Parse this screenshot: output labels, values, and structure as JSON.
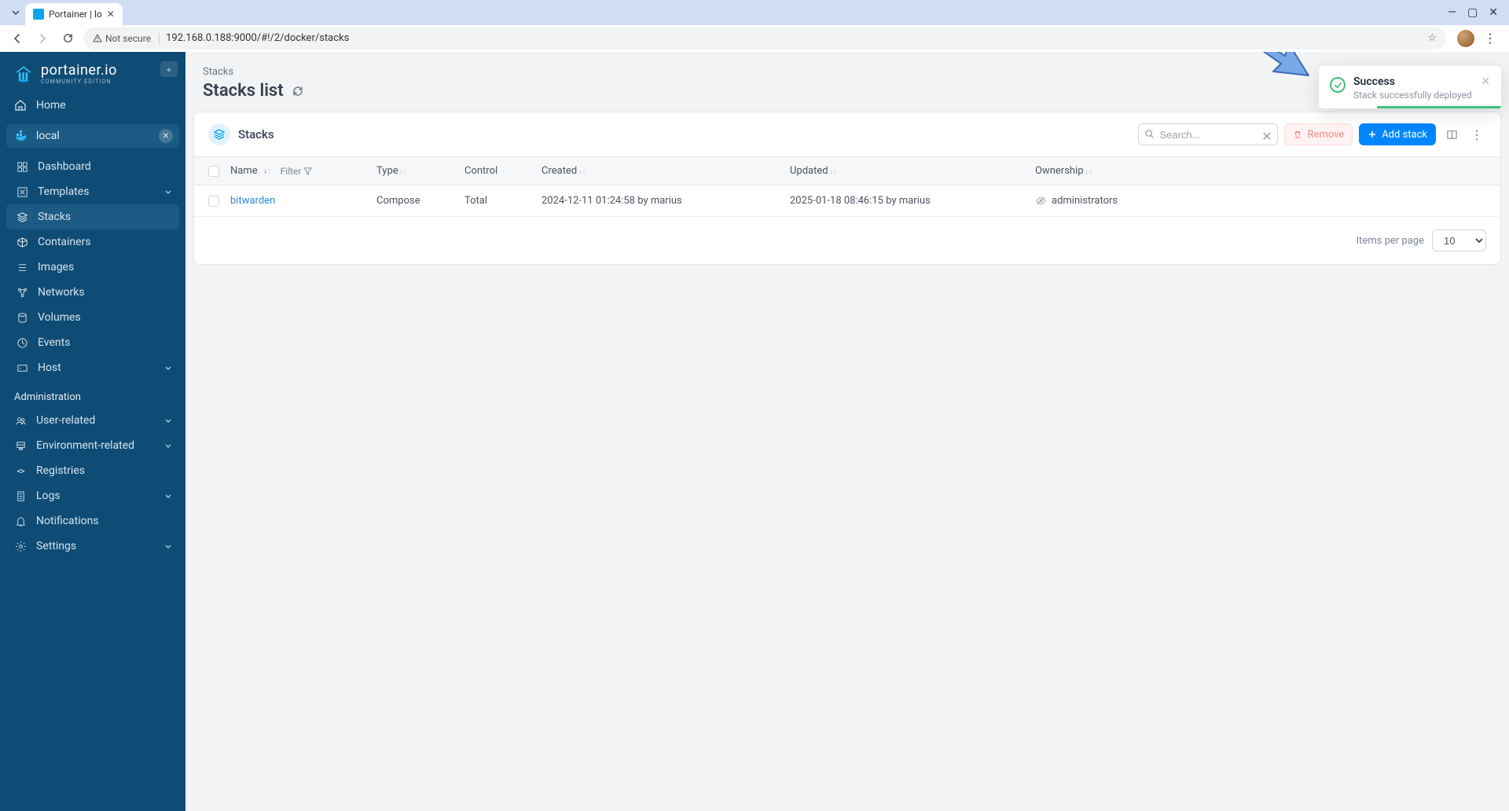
{
  "browser": {
    "tab_title": "Portainer | lo",
    "secure_label": "Not secure",
    "url": "192.168.0.188:9000/#!/2/docker/stacks"
  },
  "sidebar": {
    "product_name": "portainer.io",
    "edition": "COMMUNITY EDITION",
    "home": "Home",
    "env_name": "local",
    "items": {
      "dashboard": "Dashboard",
      "templates": "Templates",
      "stacks": "Stacks",
      "containers": "Containers",
      "images": "Images",
      "networks": "Networks",
      "volumes": "Volumes",
      "events": "Events",
      "host": "Host"
    },
    "admin_label": "Administration",
    "admin": {
      "user": "User-related",
      "env": "Environment-related",
      "registries": "Registries",
      "logs": "Logs",
      "notifications": "Notifications",
      "settings": "Settings"
    }
  },
  "page": {
    "breadcrumb": "Stacks",
    "title": "Stacks list"
  },
  "panel": {
    "title": "Stacks",
    "search_placeholder": "Search...",
    "remove": "Remove",
    "add": "Add stack",
    "cols": {
      "name": "Name",
      "filter": "Filter",
      "type": "Type",
      "control": "Control",
      "created": "Created",
      "updated": "Updated",
      "ownership": "Ownership"
    },
    "rows": [
      {
        "name": "bitwarden",
        "type": "Compose",
        "control": "Total",
        "created": "2024-12-11 01:24:58 by marius",
        "updated": "2025-01-18 08:46:15 by marius",
        "ownership": "administrators"
      }
    ],
    "footer": {
      "ipp_label": "Items per page",
      "ipp_value": "10"
    }
  },
  "toast": {
    "title": "Success",
    "message": "Stack successfully deployed"
  }
}
